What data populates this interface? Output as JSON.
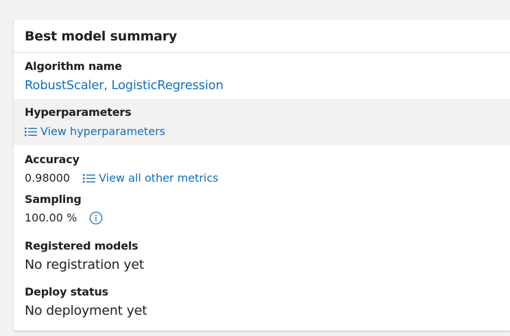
{
  "card": {
    "title": "Best model summary"
  },
  "fields": {
    "algorithm": {
      "label": "Algorithm name",
      "value": "RobustScaler, LogisticRegression"
    },
    "hyperparameters": {
      "label": "Hyperparameters",
      "link": "View hyperparameters",
      "icon": "list-icon"
    },
    "accuracy": {
      "label": "Accuracy",
      "value": "0.98000",
      "link": "View all other metrics",
      "icon": "list-icon"
    },
    "sampling": {
      "label": "Sampling",
      "value": "100.00 %",
      "icon": "info-icon"
    },
    "registered_models": {
      "label": "Registered models",
      "value": "No registration yet"
    },
    "deploy_status": {
      "label": "Deploy status",
      "value": "No deployment yet"
    }
  },
  "colors": {
    "link": "#106ebe",
    "highlight_row": "#f3f2f1",
    "text": "#201f1e"
  }
}
